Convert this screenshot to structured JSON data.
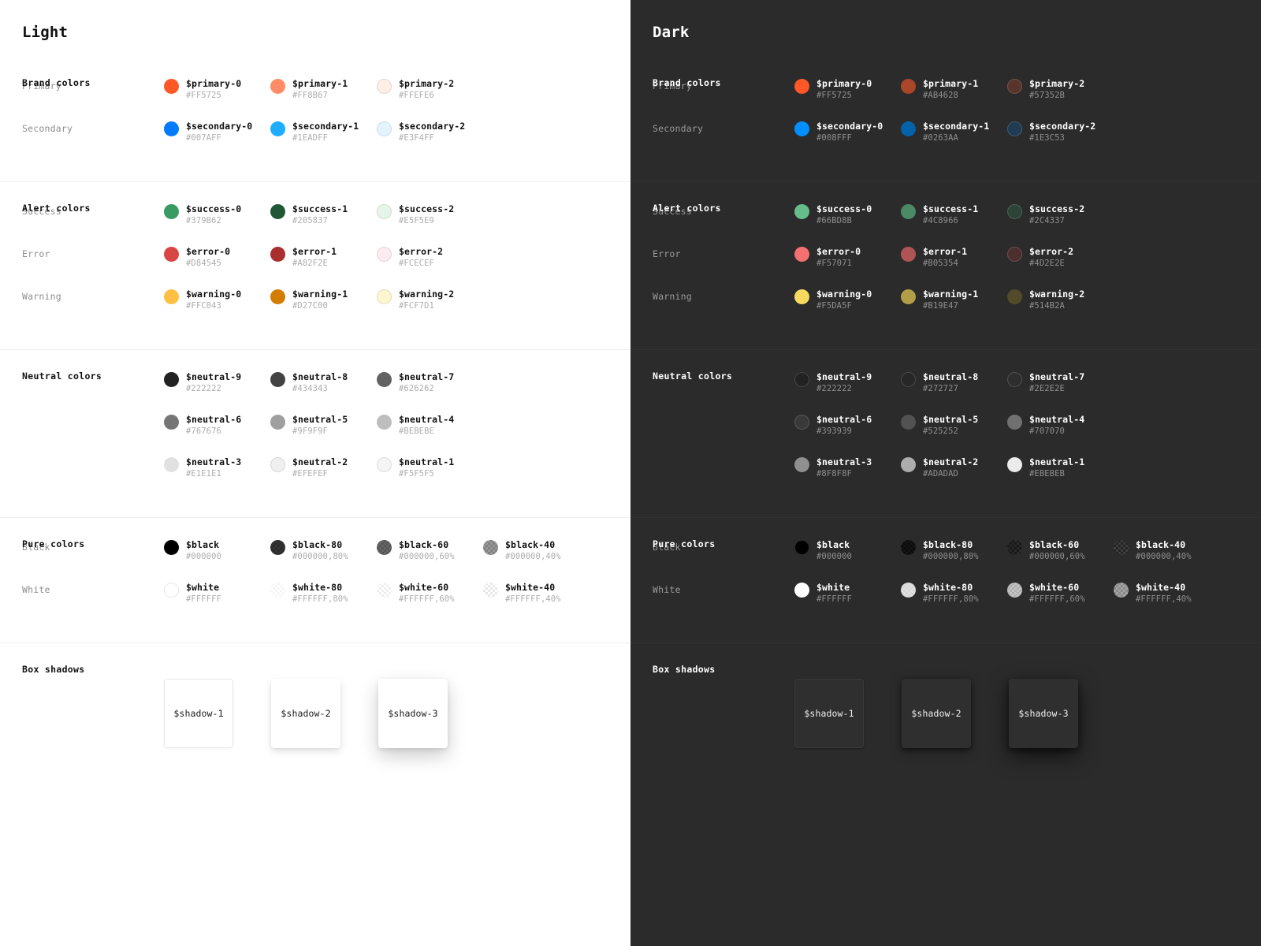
{
  "panels": [
    {
      "key": "light",
      "title": "Light",
      "background": "#FFFFFF",
      "sections": {
        "brand": {
          "title": "Brand colors",
          "rows": [
            {
              "label": "Primary",
              "swatches": [
                {
                  "name": "$primary-0",
                  "hex": "#FF5725",
                  "color": "#FF5725",
                  "alpha": false
                },
                {
                  "name": "$primary-1",
                  "hex": "#FF8B67",
                  "color": "#FF8B67",
                  "alpha": false
                },
                {
                  "name": "$primary-2",
                  "hex": "#FFEFE6",
                  "color": "#FFEFE6",
                  "alpha": false
                }
              ]
            },
            {
              "label": "Secondary",
              "swatches": [
                {
                  "name": "$secondary-0",
                  "hex": "#007AFF",
                  "color": "#007AFF",
                  "alpha": false
                },
                {
                  "name": "$secondary-1",
                  "hex": "#1EADFF",
                  "color": "#1EADFF",
                  "alpha": false
                },
                {
                  "name": "$secondary-2",
                  "hex": "#E3F4FF",
                  "color": "#E3F4FF",
                  "alpha": false
                }
              ]
            }
          ]
        },
        "alert": {
          "title": "Alert colors",
          "rows": [
            {
              "label": "Success",
              "swatches": [
                {
                  "name": "$success-0",
                  "hex": "#379B62",
                  "color": "#379B62",
                  "alpha": false
                },
                {
                  "name": "$success-1",
                  "hex": "#205837",
                  "color": "#205837",
                  "alpha": false
                },
                {
                  "name": "$success-2",
                  "hex": "#E5F5E9",
                  "color": "#E5F5E9",
                  "alpha": false
                }
              ]
            },
            {
              "label": "Error",
              "swatches": [
                {
                  "name": "$error-0",
                  "hex": "#D84545",
                  "color": "#D84545",
                  "alpha": false
                },
                {
                  "name": "$error-1",
                  "hex": "#A82F2E",
                  "color": "#A82F2E",
                  "alpha": false
                },
                {
                  "name": "$error-2",
                  "hex": "#FCECEF",
                  "color": "#FCECEF",
                  "alpha": false
                }
              ]
            },
            {
              "label": "Warning",
              "swatches": [
                {
                  "name": "$warning-0",
                  "hex": "#FFC043",
                  "color": "#FFC043",
                  "alpha": false
                },
                {
                  "name": "$warning-1",
                  "hex": "#D27C00",
                  "color": "#D27C00",
                  "alpha": false
                },
                {
                  "name": "$warning-2",
                  "hex": "#FCF7D1",
                  "color": "#FCF7D1",
                  "alpha": false
                }
              ]
            }
          ]
        },
        "neutral": {
          "title": "Neutral colors",
          "rows": [
            {
              "label": "",
              "swatches": [
                {
                  "name": "$neutral-9",
                  "hex": "#222222",
                  "color": "#222222",
                  "alpha": false
                },
                {
                  "name": "$neutral-8",
                  "hex": "#434343",
                  "color": "#434343",
                  "alpha": false
                },
                {
                  "name": "$neutral-7",
                  "hex": "#626262",
                  "color": "#626262",
                  "alpha": false
                }
              ]
            },
            {
              "label": "",
              "swatches": [
                {
                  "name": "$neutral-6",
                  "hex": "#767676",
                  "color": "#767676",
                  "alpha": false
                },
                {
                  "name": "$neutral-5",
                  "hex": "#9F9F9F",
                  "color": "#9F9F9F",
                  "alpha": false
                },
                {
                  "name": "$neutral-4",
                  "hex": "#BEBEBE",
                  "color": "#BEBEBE",
                  "alpha": false
                }
              ]
            },
            {
              "label": "",
              "swatches": [
                {
                  "name": "$neutral-3",
                  "hex": "#E1E1E1",
                  "color": "#E1E1E1",
                  "alpha": false
                },
                {
                  "name": "$neutral-2",
                  "hex": "#EFEFEF",
                  "color": "#EFEFEF",
                  "alpha": false
                },
                {
                  "name": "$neutral-1",
                  "hex": "#F5F5F5",
                  "color": "#F5F5F5",
                  "alpha": false
                }
              ]
            }
          ]
        },
        "pure": {
          "title": "Pure colors",
          "rows": [
            {
              "label": "Black",
              "swatches": [
                {
                  "name": "$black",
                  "hex": "#000000",
                  "color": "#000000",
                  "alpha": false
                },
                {
                  "name": "$black-80",
                  "hex": "#000000,80%",
                  "color": "rgba(0,0,0,0.8)",
                  "alpha": true
                },
                {
                  "name": "$black-60",
                  "hex": "#000000,60%",
                  "color": "rgba(0,0,0,0.6)",
                  "alpha": true
                },
                {
                  "name": "$black-40",
                  "hex": "#000000,40%",
                  "color": "rgba(0,0,0,0.4)",
                  "alpha": true
                }
              ]
            },
            {
              "label": "White",
              "swatches": [
                {
                  "name": "$white",
                  "hex": "#FFFFFF",
                  "color": "#FFFFFF",
                  "alpha": false
                },
                {
                  "name": "$white-80",
                  "hex": "#FFFFFF,80%",
                  "color": "rgba(255,255,255,0.8)",
                  "alpha": true
                },
                {
                  "name": "$white-60",
                  "hex": "#FFFFFF,60%",
                  "color": "rgba(255,255,255,0.6)",
                  "alpha": true
                },
                {
                  "name": "$white-40",
                  "hex": "#FFFFFF,40%",
                  "color": "rgba(255,255,255,0.4)",
                  "alpha": true
                }
              ]
            }
          ]
        },
        "shadows": {
          "title": "Box shadows",
          "cards": [
            {
              "name": "$shadow-1"
            },
            {
              "name": "$shadow-2"
            },
            {
              "name": "$shadow-3"
            }
          ]
        }
      }
    },
    {
      "key": "dark",
      "title": "Dark",
      "background": "#2B2B2B",
      "sections": {
        "brand": {
          "title": "Brand colors",
          "rows": [
            {
              "label": "Primary",
              "swatches": [
                {
                  "name": "$primary-0",
                  "hex": "#FF5725",
                  "color": "#FF5725",
                  "alpha": false
                },
                {
                  "name": "$primary-1",
                  "hex": "#AB4628",
                  "color": "#AB4628",
                  "alpha": false
                },
                {
                  "name": "$primary-2",
                  "hex": "#57352B",
                  "color": "#57352B",
                  "alpha": false
                }
              ]
            },
            {
              "label": "Secondary",
              "swatches": [
                {
                  "name": "$secondary-0",
                  "hex": "#008FFF",
                  "color": "#008FFF",
                  "alpha": false
                },
                {
                  "name": "$secondary-1",
                  "hex": "#0263AA",
                  "color": "#0263AA",
                  "alpha": false
                },
                {
                  "name": "$secondary-2",
                  "hex": "#1E3C53",
                  "color": "#1E3C53",
                  "alpha": false
                }
              ]
            }
          ]
        },
        "alert": {
          "title": "Alert colors",
          "rows": [
            {
              "label": "Success",
              "swatches": [
                {
                  "name": "$success-0",
                  "hex": "#66BD8B",
                  "color": "#66BD8B",
                  "alpha": false
                },
                {
                  "name": "$success-1",
                  "hex": "#4C8966",
                  "color": "#4C8966",
                  "alpha": false
                },
                {
                  "name": "$success-2",
                  "hex": "#2C4337",
                  "color": "#2C4337",
                  "alpha": false
                }
              ]
            },
            {
              "label": "Error",
              "swatches": [
                {
                  "name": "$error-0",
                  "hex": "#F57071",
                  "color": "#F57071",
                  "alpha": false
                },
                {
                  "name": "$error-1",
                  "hex": "#B05354",
                  "color": "#B05354",
                  "alpha": false
                },
                {
                  "name": "$error-2",
                  "hex": "#4D2E2E",
                  "color": "#4D2E2E",
                  "alpha": false
                }
              ]
            },
            {
              "label": "Warning",
              "swatches": [
                {
                  "name": "$warning-0",
                  "hex": "#F5DA5F",
                  "color": "#F5DA5F",
                  "alpha": false
                },
                {
                  "name": "$warning-1",
                  "hex": "#B19E47",
                  "color": "#B19E47",
                  "alpha": false
                },
                {
                  "name": "$warning-2",
                  "hex": "#514B2A",
                  "color": "#514B2A",
                  "alpha": false
                }
              ]
            }
          ]
        },
        "neutral": {
          "title": "Neutral colors",
          "rows": [
            {
              "label": "",
              "swatches": [
                {
                  "name": "$neutral-9",
                  "hex": "#222222",
                  "color": "#222222",
                  "alpha": false
                },
                {
                  "name": "$neutral-8",
                  "hex": "#272727",
                  "color": "#272727",
                  "alpha": false
                },
                {
                  "name": "$neutral-7",
                  "hex": "#2E2E2E",
                  "color": "#2E2E2E",
                  "alpha": false
                }
              ]
            },
            {
              "label": "",
              "swatches": [
                {
                  "name": "$neutral-6",
                  "hex": "#393939",
                  "color": "#393939",
                  "alpha": false
                },
                {
                  "name": "$neutral-5",
                  "hex": "#525252",
                  "color": "#525252",
                  "alpha": false
                },
                {
                  "name": "$neutral-4",
                  "hex": "#707070",
                  "color": "#707070",
                  "alpha": false
                }
              ]
            },
            {
              "label": "",
              "swatches": [
                {
                  "name": "$neutral-3",
                  "hex": "#8F8F8F",
                  "color": "#8F8F8F",
                  "alpha": false
                },
                {
                  "name": "$neutral-2",
                  "hex": "#ADADAD",
                  "color": "#ADADAD",
                  "alpha": false
                },
                {
                  "name": "$neutral-1",
                  "hex": "#EBEBEB",
                  "color": "#EBEBEB",
                  "alpha": false
                }
              ]
            }
          ]
        },
        "pure": {
          "title": "Pure colors",
          "rows": [
            {
              "label": "Black",
              "swatches": [
                {
                  "name": "$black",
                  "hex": "#000000",
                  "color": "#000000",
                  "alpha": false
                },
                {
                  "name": "$black-80",
                  "hex": "#000000,80%",
                  "color": "rgba(0,0,0,0.8)",
                  "alpha": true
                },
                {
                  "name": "$black-60",
                  "hex": "#000000,60%",
                  "color": "rgba(0,0,0,0.6)",
                  "alpha": true
                },
                {
                  "name": "$black-40",
                  "hex": "#000000,40%",
                  "color": "rgba(0,0,0,0.4)",
                  "alpha": true
                }
              ]
            },
            {
              "label": "White",
              "swatches": [
                {
                  "name": "$white",
                  "hex": "#FFFFFF",
                  "color": "#FFFFFF",
                  "alpha": false
                },
                {
                  "name": "$white-80",
                  "hex": "#FFFFFF,80%",
                  "color": "rgba(255,255,255,0.8)",
                  "alpha": true
                },
                {
                  "name": "$white-60",
                  "hex": "#FFFFFF,60%",
                  "color": "rgba(255,255,255,0.6)",
                  "alpha": true
                },
                {
                  "name": "$white-40",
                  "hex": "#FFFFFF,40%",
                  "color": "rgba(255,255,255,0.4)",
                  "alpha": true
                }
              ]
            }
          ]
        },
        "shadows": {
          "title": "Box shadows",
          "cards": [
            {
              "name": "$shadow-1"
            },
            {
              "name": "$shadow-2"
            },
            {
              "name": "$shadow-3"
            }
          ]
        }
      }
    }
  ]
}
